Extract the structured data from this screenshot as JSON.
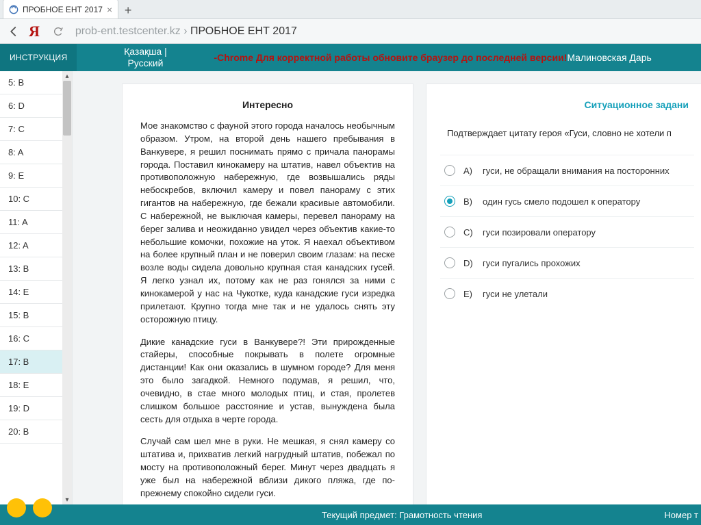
{
  "browser": {
    "tab_title": "ПРОБНОЕ ЕНТ 2017",
    "url_host": "prob-ent.testcenter.kz",
    "url_sep": " › ",
    "url_path": "ПРОБНОЕ ЕНТ 2017"
  },
  "banner": {
    "instruction": "ИНСТРУКЦИЯ",
    "lang_kk": "Қазақша |",
    "lang_ru": "Русский",
    "warning": "-Chrome Для корректной работы обновите браузер до последней версии!",
    "username": "Малиновская Дарь"
  },
  "sidebar": {
    "items": [
      {
        "label": "5: B"
      },
      {
        "label": "6: D"
      },
      {
        "label": "7: C"
      },
      {
        "label": "8: A"
      },
      {
        "label": "9: E"
      },
      {
        "label": "10: C"
      },
      {
        "label": "11: A"
      },
      {
        "label": "12: A"
      },
      {
        "label": "13: B"
      },
      {
        "label": "14: E"
      },
      {
        "label": "15: B"
      },
      {
        "label": "16: C"
      },
      {
        "label": "17: B"
      },
      {
        "label": "18: E"
      },
      {
        "label": "19: D"
      },
      {
        "label": "20: B"
      }
    ],
    "selected_index": 12
  },
  "passage": {
    "title": "Интересно",
    "p1": "Мое знакомство с фауной этого города началось необычным образом. Утром, на второй день нашего пребывания в Ванкувере, я решил поснимать прямо с причала панорамы города. Поставил кинокамеру на штатив, навел объектив на противоположную набережную, где возвышались ряды небоскребов, включил камеру и повел панораму с этих гигантов на набережную, где бежали красивые автомобили. С набережной, не выключая камеры, перевел панораму на берег залива и неожиданно увидел через объектив какие-то небольшие комочки, похожие на уток. Я наехал объективом на более крупный план и не поверил своим глазам: на песке возле воды сидела довольно крупная стая канадских гусей. Я легко узнал их, потому как не раз гонялся за ними с кинокамерой у нас на Чукотке, куда канадские гуси изредка прилетают. Крупно тогда мне так и не удалось снять эту осторожную птицу.",
    "p2": "Дикие канадские гуси в Ванкувере?! Эти прирожденные стайеры, способные покрывать в полете огромные дистанции! Как они оказались в шумном городе? Для меня это было загадкой. Немного подумав, я решил, что, очевидно, в стае много молодых птиц, и стая, пролетев слишком большое расстояние и устав, вынуждена была сесть для отдыха в черте города.",
    "p3": "Случай сам шел мне в руки. Не мешкая, я снял камеру со штатива и, прихватив легкий нагрудный штатив, побежал по мосту на противоположный берег. Минут через двадцать я уже был на набережной вблизи дикого пляжа, где по-прежнему спокойно сидели гуси."
  },
  "question": {
    "heading": "Ситуационное задани",
    "text": "Подтверждает цитату героя  «Гуси, словно не хотели п",
    "options": [
      {
        "letter": "A)",
        "text": "гуси, не обращали внимания на посторонних"
      },
      {
        "letter": "B)",
        "text": "один гусь смело подошел к оператору"
      },
      {
        "letter": "C)",
        "text": "гуси позировали оператору"
      },
      {
        "letter": "D)",
        "text": "гуси пугались прохожих"
      },
      {
        "letter": "E)",
        "text": "гуси не улетали"
      }
    ],
    "selected_index": 1
  },
  "footer": {
    "subject": "Текущий предмет: Грамотность чтения",
    "num": "Номер т"
  }
}
